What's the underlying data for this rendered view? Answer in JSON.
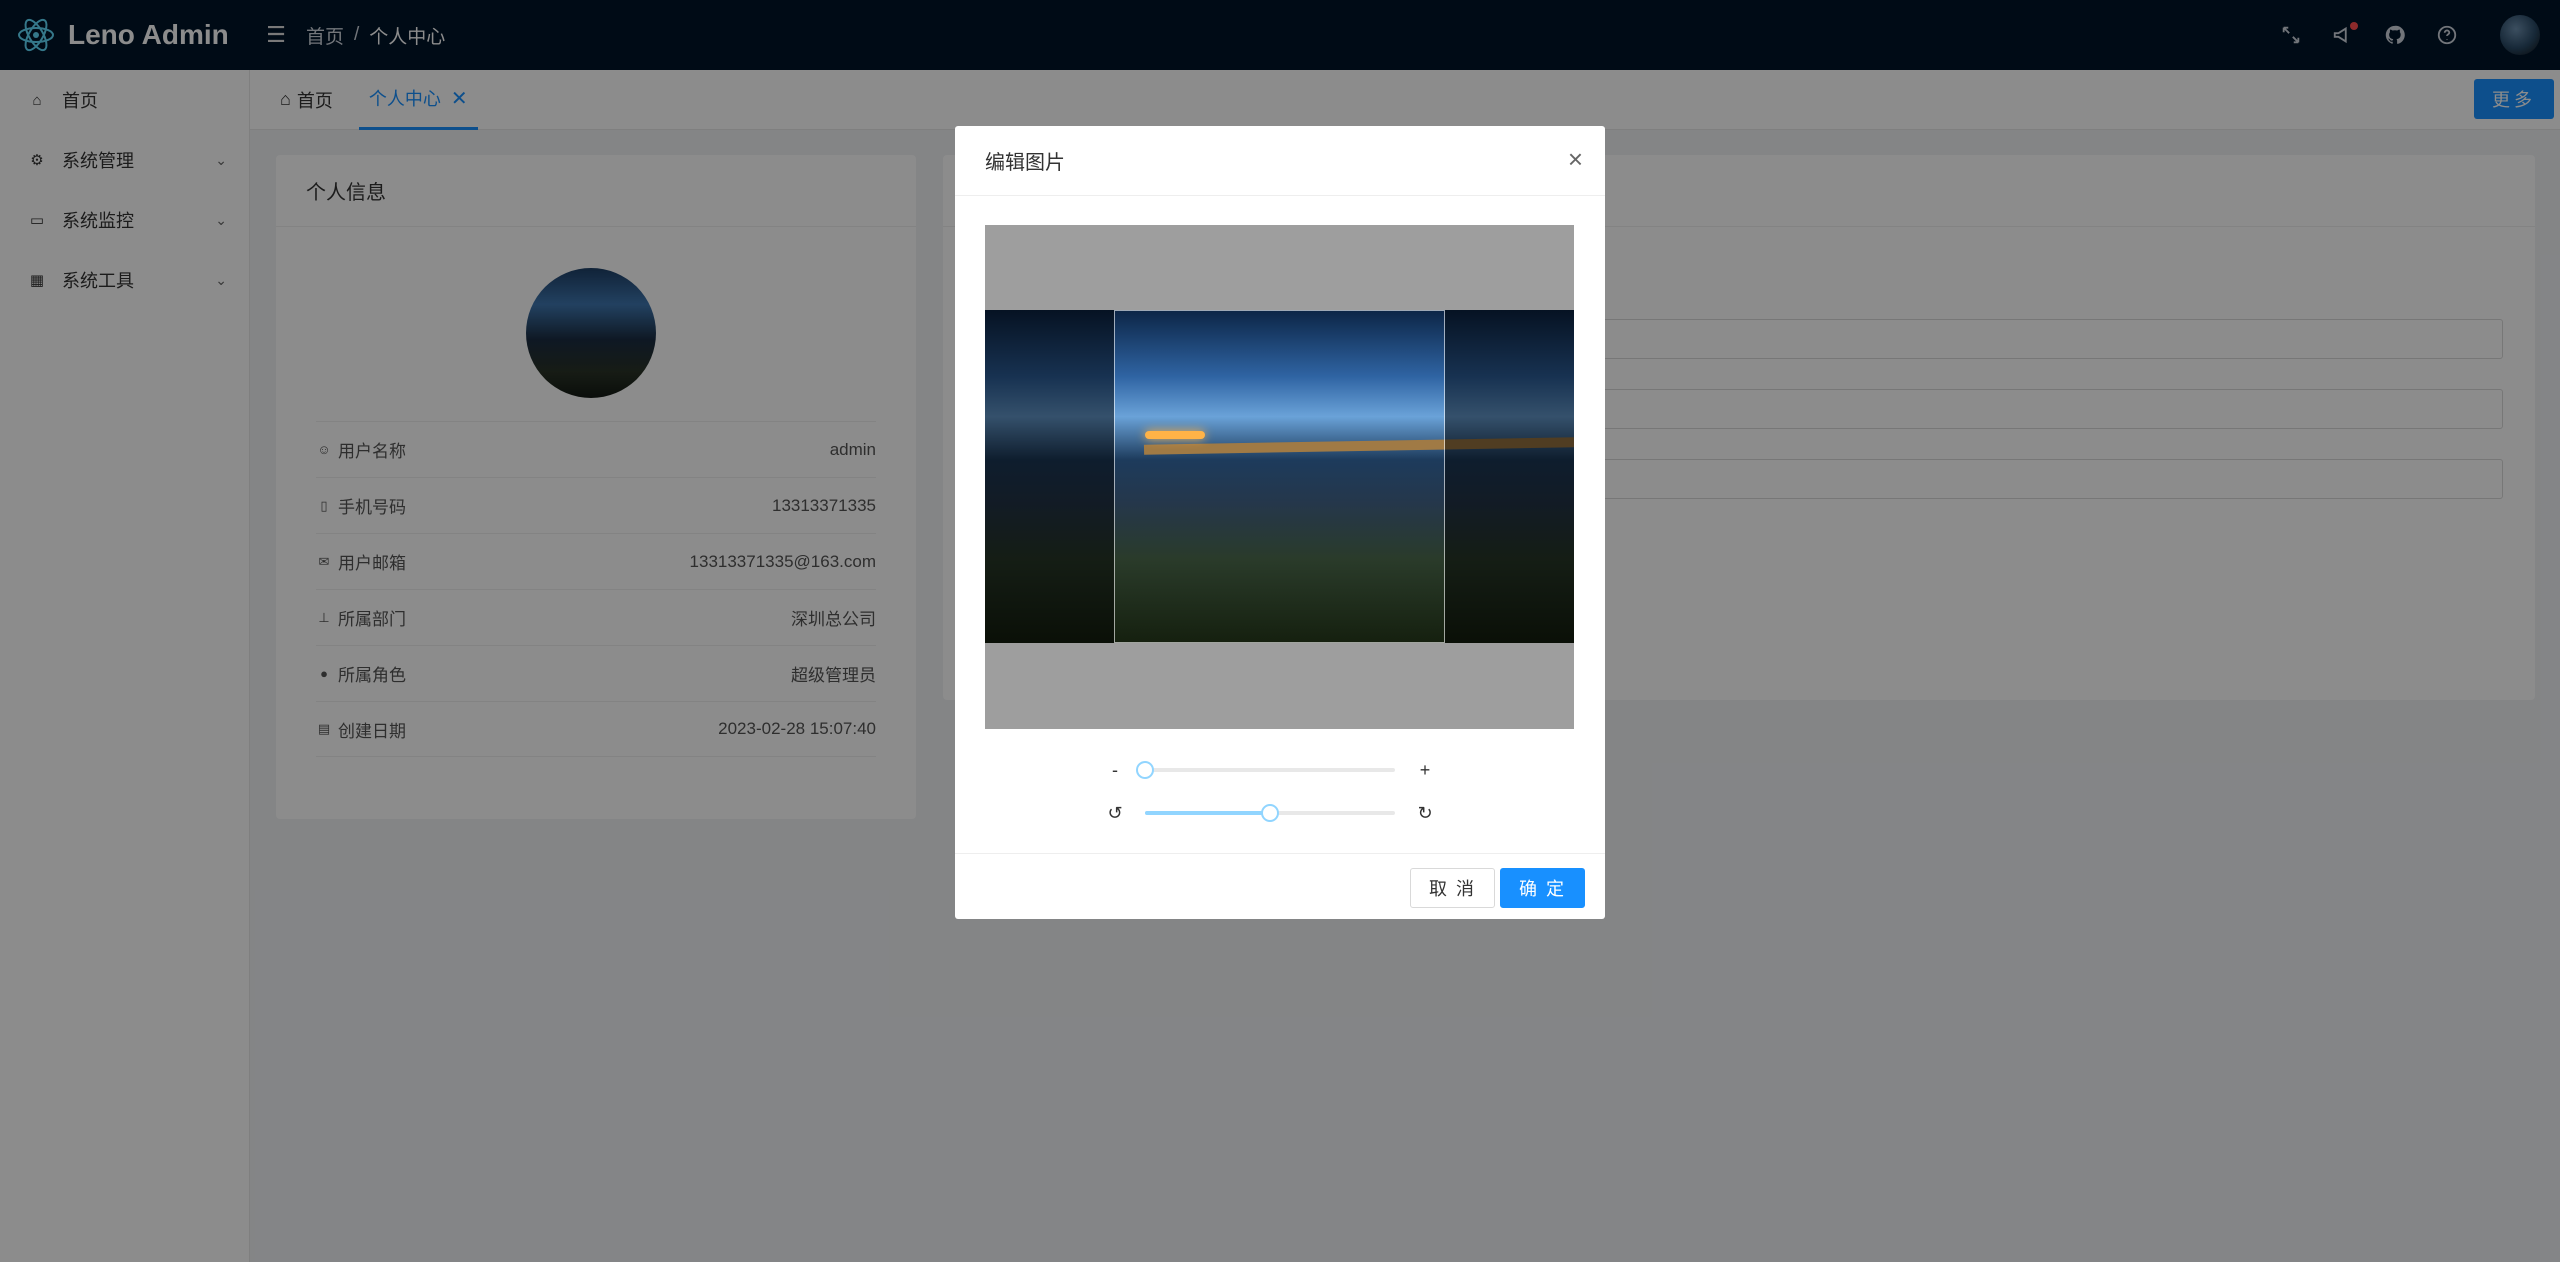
{
  "app": {
    "title": "Leno Admin"
  },
  "breadcrumb": {
    "home": "首页",
    "separator": "/",
    "current": "个人中心"
  },
  "header_icons": [
    "fullscreen-icon",
    "megaphone-icon",
    "github-icon",
    "help-icon"
  ],
  "sidebar": {
    "items": [
      {
        "label": "首页",
        "icon": "home-icon"
      },
      {
        "label": "系统管理",
        "icon": "gear-icon",
        "arrow": "⌄"
      },
      {
        "label": "系统监控",
        "icon": "monitor-icon",
        "arrow": "⌄"
      },
      {
        "label": "系统工具",
        "icon": "grid-icon",
        "arrow": "⌄"
      }
    ]
  },
  "tabs": [
    {
      "label": "首页"
    },
    {
      "label": "个人中心",
      "close": "✕"
    }
  ],
  "more_button": "更多",
  "profile_card": {
    "title": "个人信息",
    "rows": [
      {
        "label": "用户名称",
        "value": "admin"
      },
      {
        "label": "手机号码",
        "value": "13313371335"
      },
      {
        "label": "用户邮箱",
        "value": "13313371335@163.com"
      },
      {
        "label": "所属部门",
        "value": "深圳总公司"
      },
      {
        "label": "所属角色",
        "value": "超级管理员"
      },
      {
        "label": "创建日期",
        "value": "2023-02-28 15:07:40"
      }
    ]
  },
  "modal": {
    "title": "编辑图片",
    "close": "×",
    "zoom_minus": "-",
    "zoom_plus": "+",
    "zoom_value": 0,
    "rotate_value": 0.5,
    "rotate_left": "↺",
    "rotate_right": "↻",
    "cancel": "取 消",
    "ok": "确 定"
  },
  "colors": {
    "primary": "#1890ff",
    "header_bg": "#001529",
    "slider": "#91d5ff"
  }
}
